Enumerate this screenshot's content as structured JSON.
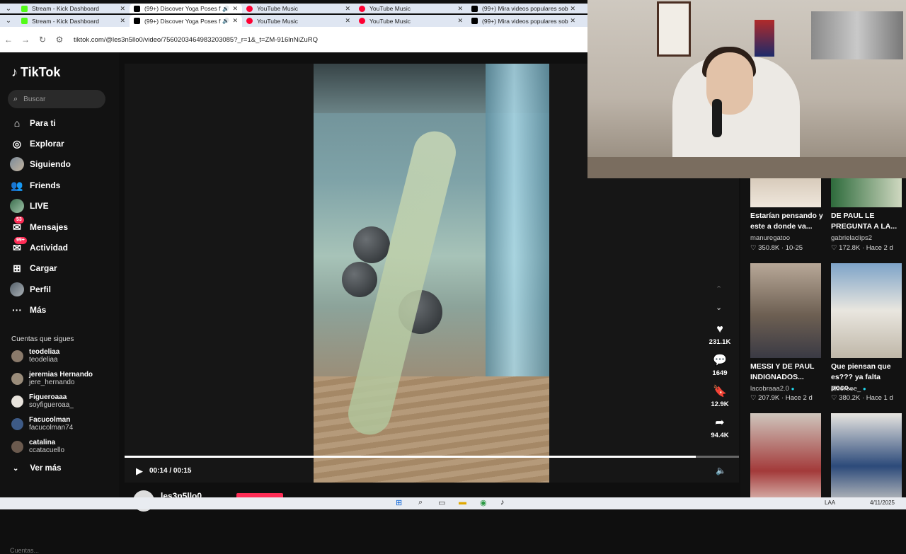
{
  "browser": {
    "tabs_row1": [
      {
        "title": "Stream - Kick Dashboard",
        "color": "#53fc18"
      },
      {
        "title": "(99+) Discover Yoga Poses f",
        "color": "#000000",
        "active": true
      },
      {
        "title": "YouTube Music",
        "color": "#ff0033"
      },
      {
        "title": "YouTube Music",
        "color": "#ff0033"
      },
      {
        "title": "(99+) Mira videos populares sob",
        "color": "#000000"
      }
    ],
    "tabs_row2": [
      {
        "title": "Stream - Kick Dashboard",
        "color": "#53fc18"
      },
      {
        "title": "(99+) Discover Yoga Poses f",
        "color": "#000000",
        "active": true
      },
      {
        "title": "YouTube Music",
        "color": "#ff0033"
      },
      {
        "title": "YouTube Music",
        "color": "#ff0033"
      },
      {
        "title": "(99+) Mira videos populares sob",
        "color": "#000000"
      }
    ],
    "url": "tiktok.com/@les3n5llo0/video/7560203464983203085?_r=1&_t=ZM-916lnNiZuRQ"
  },
  "sidebar": {
    "logo": "TikTok",
    "search_placeholder": "Buscar",
    "nav": [
      {
        "label": "Para ti",
        "icon": "home-icon"
      },
      {
        "label": "Explorar",
        "icon": "compass-icon"
      },
      {
        "label": "Siguiendo",
        "icon": "following-avatar-icon"
      },
      {
        "label": "Friends",
        "icon": "friends-icon"
      },
      {
        "label": "LIVE",
        "icon": "live-icon"
      },
      {
        "label": "Mensajes",
        "icon": "messages-icon",
        "badge": "53"
      },
      {
        "label": "Actividad",
        "icon": "activity-icon",
        "badge": "99+"
      },
      {
        "label": "Cargar",
        "icon": "upload-icon"
      },
      {
        "label": "Perfil",
        "icon": "profile-avatar-icon"
      },
      {
        "label": "Más",
        "icon": "more-icon"
      }
    ],
    "following_title": "Cuentas que sigues",
    "following": [
      {
        "name": "teodeliaa",
        "handle": "teodeliaa"
      },
      {
        "name": "jeremias Hernando",
        "handle": "jere_hernando"
      },
      {
        "name": "Figueroaaa",
        "handle": "soyfigueroaa_"
      },
      {
        "name": "Facucolman",
        "handle": "facucolman74"
      },
      {
        "name": "catalina",
        "handle": "ccatacuello"
      }
    ],
    "ver_mas": "Ver más",
    "bottom_fade": "Cuentas..."
  },
  "player": {
    "time": "00:14 / 00:15",
    "progress": 0.93,
    "author": "les3n5llo0",
    "actions": [
      {
        "icon": "heart-icon",
        "count": "231.1K"
      },
      {
        "icon": "comment-icon",
        "count": "1649"
      },
      {
        "icon": "bookmark-icon",
        "count": "12.9K"
      },
      {
        "icon": "share-icon",
        "count": "94.4K"
      }
    ]
  },
  "suggestions": [
    {
      "title": "Estarían pensando y este a donde va...",
      "user": "manuregatoo",
      "likes": "350.8K",
      "date": "10-25",
      "verified": false
    },
    {
      "title": "DE PAUL LE PREGUNTA A LA...",
      "user": "gabrielaclips2",
      "likes": "172.8K",
      "date": "Hace 2 d",
      "verified": false
    },
    {
      "title": "MESSI Y DE PAUL INDIGNADOS...",
      "user": "lacobraaa2.0",
      "likes": "207.9K",
      "date": "Hace 2 d",
      "verified": true
    },
    {
      "title": "Que piensan que es??? ya falta poco...",
      "user": "albereee_",
      "likes": "380.2K",
      "date": "Hace 1 d",
      "verified": true
    }
  ],
  "taskbar": {
    "lang": "LAA",
    "date": "4/11/2025"
  }
}
